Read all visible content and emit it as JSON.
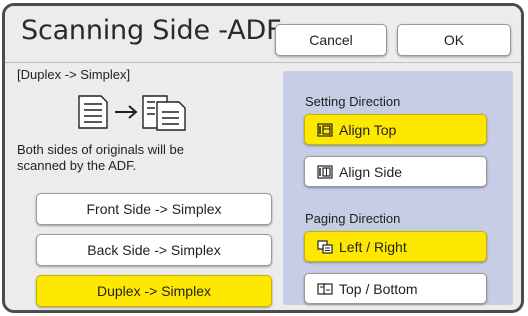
{
  "title": "Scanning Side -ADF",
  "buttons": {
    "cancel": "Cancel",
    "ok": "OK"
  },
  "left": {
    "mode_label": "[Duplex -> Simplex]",
    "description": "Both sides of originals will be scanned by the ADF.",
    "options": [
      {
        "label": "Front Side -> Simplex",
        "selected": false
      },
      {
        "label": "Back Side -> Simplex",
        "selected": false
      },
      {
        "label": "Duplex -> Simplex",
        "selected": true
      }
    ]
  },
  "right": {
    "setting_direction_label": "Setting Direction",
    "setting_direction_options": [
      {
        "label": "Align Top",
        "icon": "align-top-icon",
        "selected": true
      },
      {
        "label": "Align Side",
        "icon": "align-side-icon",
        "selected": false
      }
    ],
    "paging_direction_label": "Paging Direction",
    "paging_direction_options": [
      {
        "label": "Left / Right",
        "icon": "left-right-paging-icon",
        "selected": true
      },
      {
        "label": "Top / Bottom",
        "icon": "top-bottom-paging-icon",
        "selected": false
      }
    ]
  },
  "colors": {
    "selected": "#ffe800",
    "panel": "#c7cde6",
    "background": "#ececec"
  }
}
